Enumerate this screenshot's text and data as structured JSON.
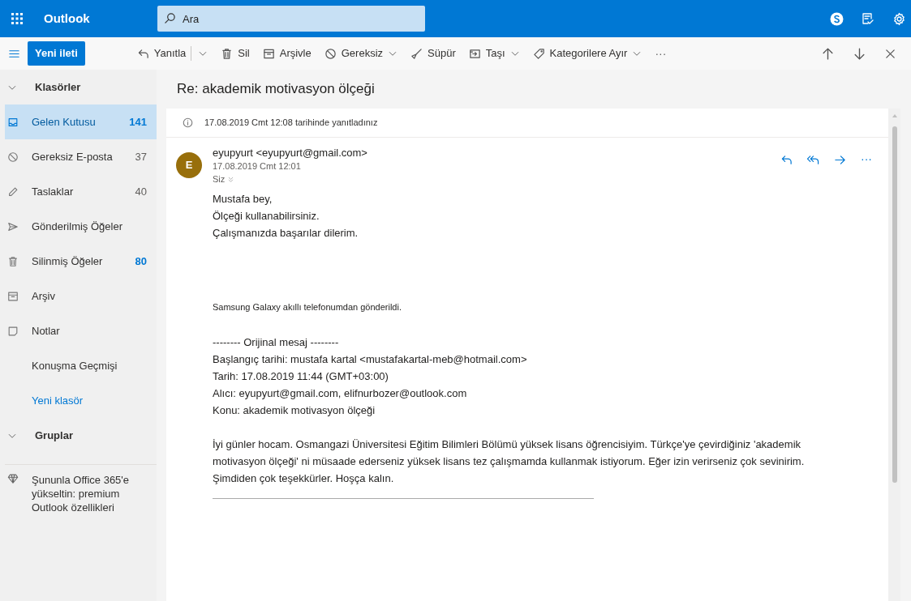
{
  "top_bar": {
    "app_name": "Outlook",
    "search": {
      "placeholder": "Ara"
    }
  },
  "toolbar": {
    "new_message": "Yeni ileti",
    "actions": [
      {
        "kind": "reply",
        "label": "Yanıtla",
        "dropdown": true
      },
      {
        "kind": "delete",
        "label": "Sil",
        "dropdown": false
      },
      {
        "kind": "archive",
        "label": "Arşivle",
        "dropdown": false
      },
      {
        "kind": "junk",
        "label": "Gereksiz",
        "dropdown": true
      },
      {
        "kind": "sweep",
        "label": "Süpür",
        "dropdown": false
      },
      {
        "kind": "move",
        "label": "Taşı",
        "dropdown": true
      },
      {
        "kind": "tag",
        "label": "Kategorilere Ayır",
        "dropdown": true
      }
    ],
    "more": "···"
  },
  "sidebar": {
    "folders_header": "Klasörler",
    "folders": [
      {
        "kind": "inbox",
        "label": "Gelen Kutusu",
        "count": "141",
        "unread": true,
        "selected": true
      },
      {
        "kind": "junk",
        "label": "Gereksiz E-posta",
        "count": "37",
        "unread": false,
        "selected": false
      },
      {
        "kind": "drafts",
        "label": "Taslaklar",
        "count": "40",
        "unread": false,
        "selected": false
      },
      {
        "kind": "sent",
        "label": "Gönderilmiş Öğeler",
        "selected": false
      },
      {
        "kind": "deleted",
        "label": "Silinmiş Öğeler",
        "count": "80",
        "unread": true,
        "selected": false
      },
      {
        "kind": "archive",
        "label": "Arşiv",
        "selected": false
      },
      {
        "kind": "notes",
        "label": "Notlar",
        "selected": false
      },
      {
        "kind": "plain",
        "label": "Konuşma Geçmişi",
        "selected": false
      }
    ],
    "new_folder": "Yeni klasör",
    "groups_header": "Gruplar",
    "promo": "Şununla Office 365'e yükseltin: premium Outlook özellikleri"
  },
  "message": {
    "subject": "Re: akademik motivasyon ölçeği",
    "notice": "17.08.2019 Cmt 12:08 tarihinde yanıtladınız",
    "avatar_initial": "E",
    "sender": "eyupyurt <eyupyurt@gmail.com>",
    "date": "17.08.2019 Cmt 12:01",
    "to": "Siz",
    "greeting_lines": [
      "Mustafa bey,",
      "Ölçeği kullanabilirsiniz.",
      "Çalışmanızda başarılar dilerim."
    ],
    "signature": "Samsung Galaxy akıllı telefonumdan gönderildi.",
    "original_header_lines": [
      "-------- Orijinal mesaj --------",
      "Başlangıç tarihi: mustafa kartal <mustafakartal-meb@hotmail.com>",
      "Tarih: 17.08.2019 11:44 (GMT+03:00)",
      "Alıcı: eyupyurt@gmail.com, elifnurbozer@outlook.com",
      "Konu: akademik motivasyon ölçeği"
    ],
    "original_body": "İyi günler hocam. Osmangazi Üniversitesi Eğitim Bilimleri Bölümü yüksek lisans öğrencisiyim. Türkçe'ye çevirdiğiniz 'akademik motivasyon ölçeği' ni  müsaade ederseniz yüksek lisans tez çalışmamda kullanmak istiyorum. Eğer izin verirseniz çok sevinirim. Şimdiden çok teşekkürler. Hoşça kalın."
  }
}
